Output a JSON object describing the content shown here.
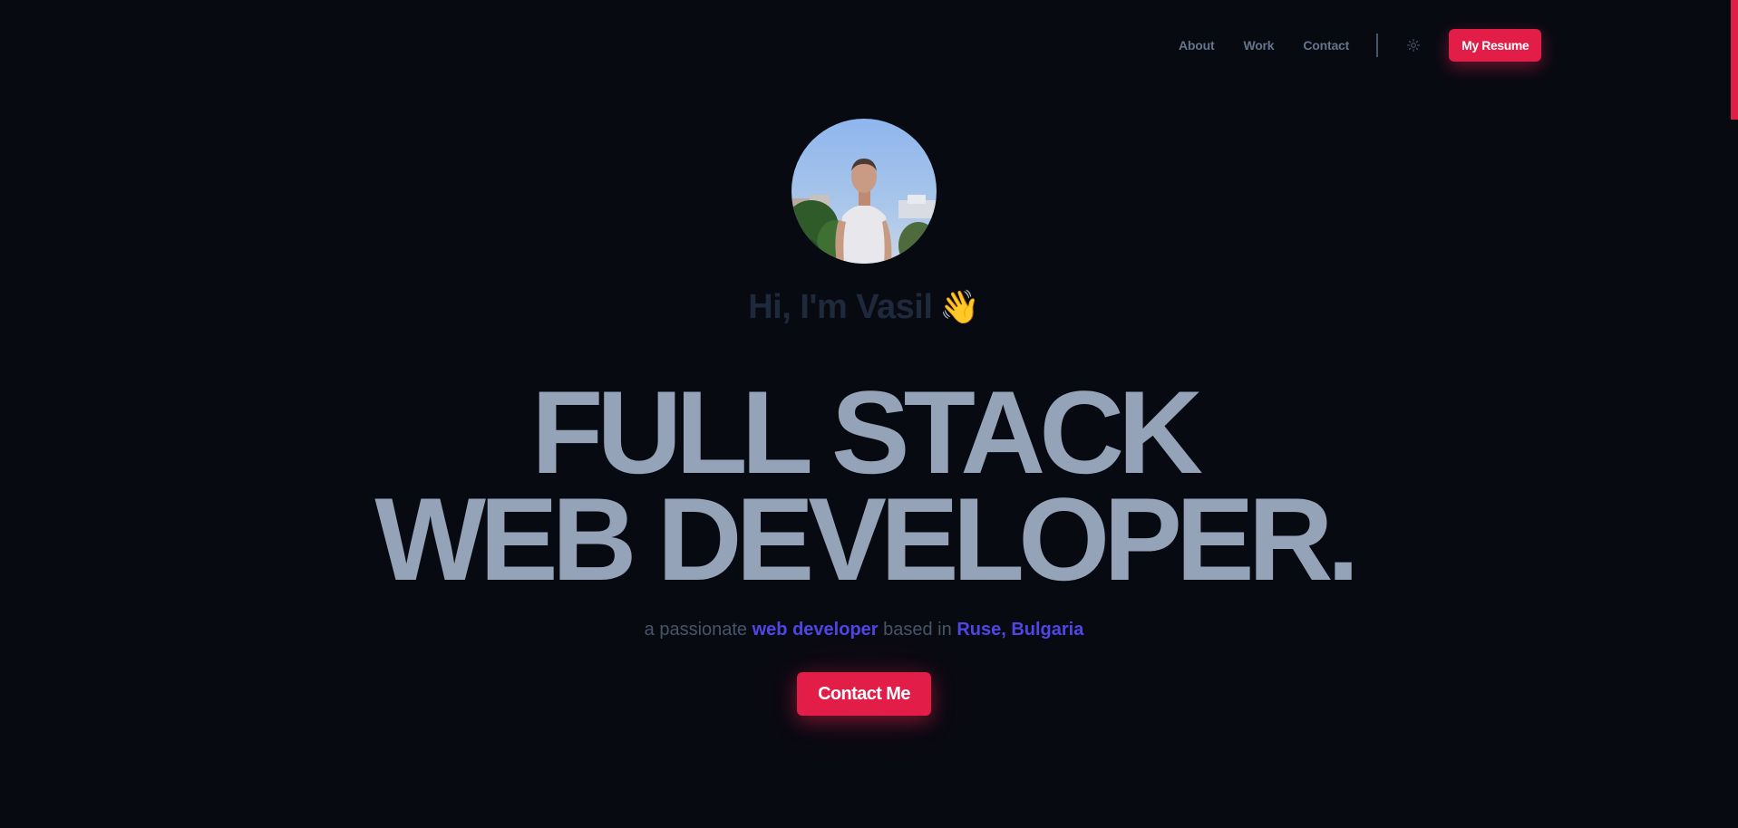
{
  "nav": {
    "links": [
      {
        "label": "About"
      },
      {
        "label": "Work"
      },
      {
        "label": "Contact"
      }
    ],
    "theme_icon": "sun-icon",
    "resume_label": "My Resume"
  },
  "hero": {
    "avatar_icon": "profile-photo",
    "greeting": "Hi, I'm Vasil",
    "greeting_emoji": "👋",
    "headline_line1": "FULL STACK",
    "headline_line2": "WEB DEVELOPER.",
    "tagline": {
      "prefix": "a passionate",
      "highlight1": "web developer",
      "middle": "based in",
      "highlight2": "Ruse, Bulgaria"
    },
    "cta_label": "Contact Me"
  },
  "colors": {
    "background": "#080a12",
    "accent": "#e11d48",
    "headline": "#94a3b8",
    "highlight": "#4f46e5",
    "nav_text": "#64748b"
  }
}
